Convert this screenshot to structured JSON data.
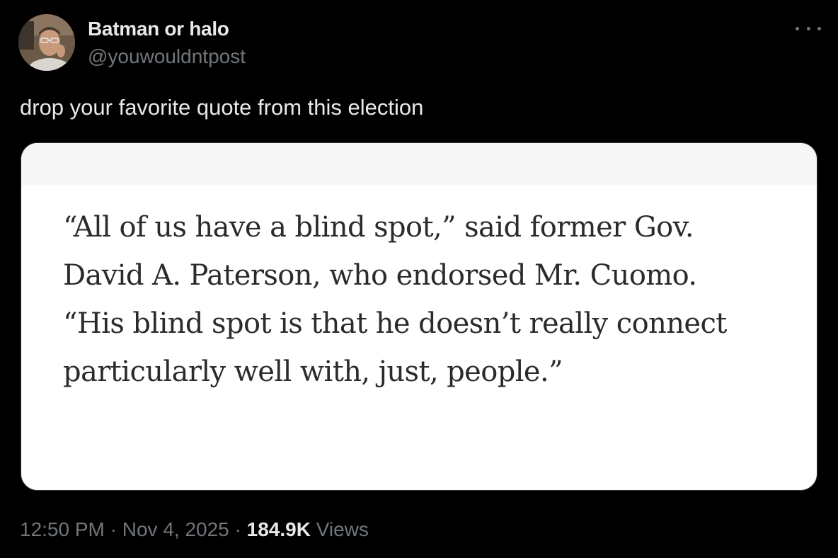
{
  "tweet": {
    "author": {
      "display_name": "Batman or halo",
      "handle": "@youwouldntpost",
      "avatar_icon": "profile-photo"
    },
    "more_icon": "more-horizontal-icon",
    "text": "drop your favorite quote from this election",
    "media": {
      "quote_lines": [
        "“All of us have a blind spot,” said former Gov.",
        "David A. Paterson, who endorsed Mr. Cuomo.",
        "“His blind spot is that he doesn’t really connect",
        "particularly well with, just, people.”"
      ]
    },
    "meta": {
      "time": "12:50 PM",
      "separator": " · ",
      "date": "Nov 4, 2025",
      "views_count": "184.9K",
      "views_label": " Views"
    }
  },
  "colors": {
    "background": "#000000",
    "primary_text": "#e7e9ea",
    "secondary_text": "#71767b",
    "card_background": "#ffffff",
    "quote_text": "#2b2b2b"
  }
}
